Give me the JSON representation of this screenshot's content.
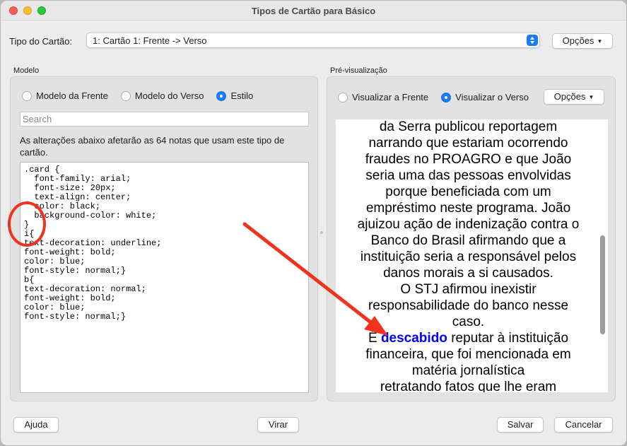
{
  "window": {
    "title": "Tipos de Cartão para Básico"
  },
  "top": {
    "card_type_label": "Tipo do Cartão:",
    "card_type_value": "1: Cartão 1: Frente -> Verso",
    "options_label": "Opções"
  },
  "left": {
    "group_label": "Modelo",
    "radios": [
      {
        "label": "Modelo da Frente",
        "selected": false
      },
      {
        "label": "Modelo do Verso",
        "selected": false
      },
      {
        "label": "Estilo",
        "selected": true
      }
    ],
    "search_placeholder": "Search",
    "notice": "As alterações abaixo afetarão as 64 notas que usam este tipo de cartão.",
    "css_code": ".card {\n  font-family: arial;\n  font-size: 20px;\n  text-align: center;\n  color: black;\n  background-color: white;\n}\ni{\ntext-decoration: underline;\nfont-weight: bold;\ncolor: blue;\nfont-style: normal;}\nb{\ntext-decoration: normal;\nfont-weight: bold;\ncolor: blue;\nfont-style: normal;}"
  },
  "right": {
    "group_label": "Pré-visualização",
    "radios": [
      {
        "label": "Visualizar a Frente",
        "selected": false
      },
      {
        "label": "Visualizar o Verso",
        "selected": true
      }
    ],
    "options_label": "Opções",
    "preview_lines": [
      "da Serra publicou reportagem",
      "narrando que estariam ocorrendo",
      "fraudes no PROAGRO e que João",
      "seria uma das pessoas envolvidas",
      "porque beneficiada com um",
      "empréstimo neste programa. João",
      "ajuizou ação de indenização contra o",
      "Banco do Brasil afirmando que a",
      "instituição seria a responsável pelos",
      "danos morais a si causados.",
      "O STJ afirmou inexistir",
      "responsabilidade do banco nesse",
      "caso."
    ],
    "highlight_prefix": "É ",
    "highlight_word": "descabido",
    "highlight_suffix": " reputar à instituição",
    "preview_lines_after": [
      "financeira, que foi mencionada em",
      "matéria jornalística",
      "retratando fatos que lhe eram"
    ]
  },
  "bottom": {
    "help_label": "Ajuda",
    "flip_label": "Virar",
    "save_label": "Salvar",
    "cancel_label": "Cancelar"
  },
  "colors": {
    "accent": "#1a7cf6",
    "annotation_red": "#f0321e",
    "preview_highlight": "#0000ff"
  }
}
